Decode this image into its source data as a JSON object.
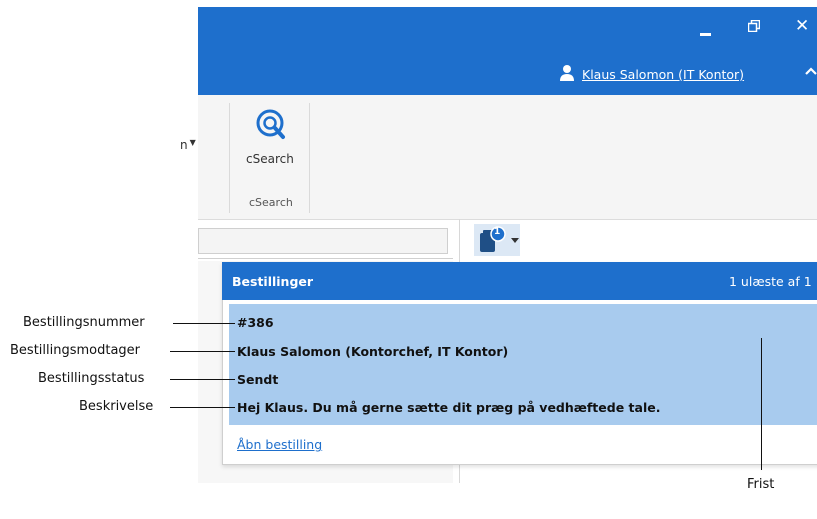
{
  "window": {
    "user_name": "Klaus Salomon (IT Kontor)",
    "controls": {
      "minimize": "minimize",
      "restore": "restore",
      "close": "✕"
    }
  },
  "ribbon": {
    "left_fragment": "n",
    "csearch_button": "cSearch",
    "csearch_group": "cSearch"
  },
  "orders_button": {
    "badge": "1"
  },
  "popup": {
    "title": "Bestillinger",
    "unread_count": "1 ulæste af 1",
    "order_number": "#386",
    "recipient": "Klaus Salomon (Kontorchef, IT Kontor)",
    "status": "Sendt",
    "description": "Hej Klaus. Du må gerne sætte dit præg på vedhæftede tale.",
    "open_link": "Åbn bestilling"
  },
  "callouts": {
    "order_number": "Bestillingsnummer",
    "recipient": "Bestillingsmodtager",
    "status": "Bestillingsstatus",
    "description": "Beskrivelse",
    "deadline": "Frist"
  },
  "colors": {
    "accent": "#1e6fcc",
    "row_highlight": "#a8cbee",
    "ribbon_bg": "#f5f5f5"
  }
}
